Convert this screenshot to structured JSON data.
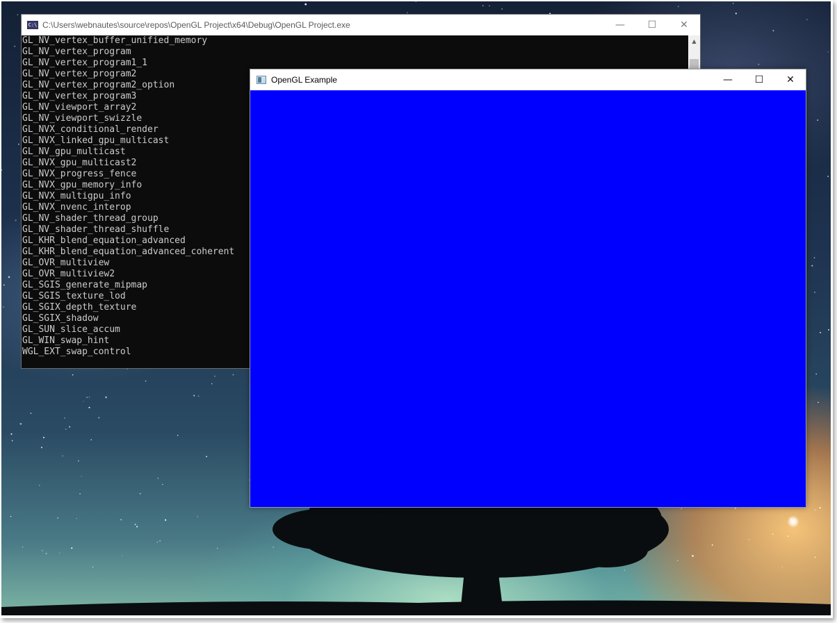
{
  "console_window": {
    "title": "C:\\Users\\webnautes\\source\\repos\\OpenGL Project\\x64\\Debug\\OpenGL Project.exe",
    "icon": "console-app-icon",
    "icon_text": "C:\\",
    "minimize_glyph": "—",
    "maximize_glyph": "☐",
    "close_glyph": "✕",
    "scroll_up_glyph": "▲",
    "lines": [
      "GL_NV_vertex_buffer_unified_memory",
      "GL_NV_vertex_program",
      "GL_NV_vertex_program1_1",
      "GL_NV_vertex_program2",
      "GL_NV_vertex_program2_option",
      "GL_NV_vertex_program3",
      "GL_NV_viewport_array2",
      "GL_NV_viewport_swizzle",
      "GL_NVX_conditional_render",
      "GL_NVX_linked_gpu_multicast",
      "GL_NV_gpu_multicast",
      "GL_NVX_gpu_multicast2",
      "GL_NVX_progress_fence",
      "GL_NVX_gpu_memory_info",
      "GL_NVX_multigpu_info",
      "GL_NVX_nvenc_interop",
      "GL_NV_shader_thread_group",
      "GL_NV_shader_thread_shuffle",
      "GL_KHR_blend_equation_advanced",
      "GL_KHR_blend_equation_advanced_coherent",
      "GL_OVR_multiview",
      "GL_OVR_multiview2",
      "GL_SGIS_generate_mipmap",
      "GL_SGIS_texture_lod",
      "GL_SGIX_depth_texture",
      "GL_SGIX_shadow",
      "GL_SUN_slice_accum",
      "GL_WIN_swap_hint",
      "WGL_EXT_swap_control"
    ]
  },
  "gl_window": {
    "title": "OpenGL Example",
    "icon": "window-app-icon",
    "clear_color": "#0000ff",
    "minimize_glyph": "—",
    "maximize_glyph": "☐",
    "close_glyph": "✕"
  },
  "wallpaper": {
    "description_icon": "starry-night-tree-wallpaper"
  }
}
